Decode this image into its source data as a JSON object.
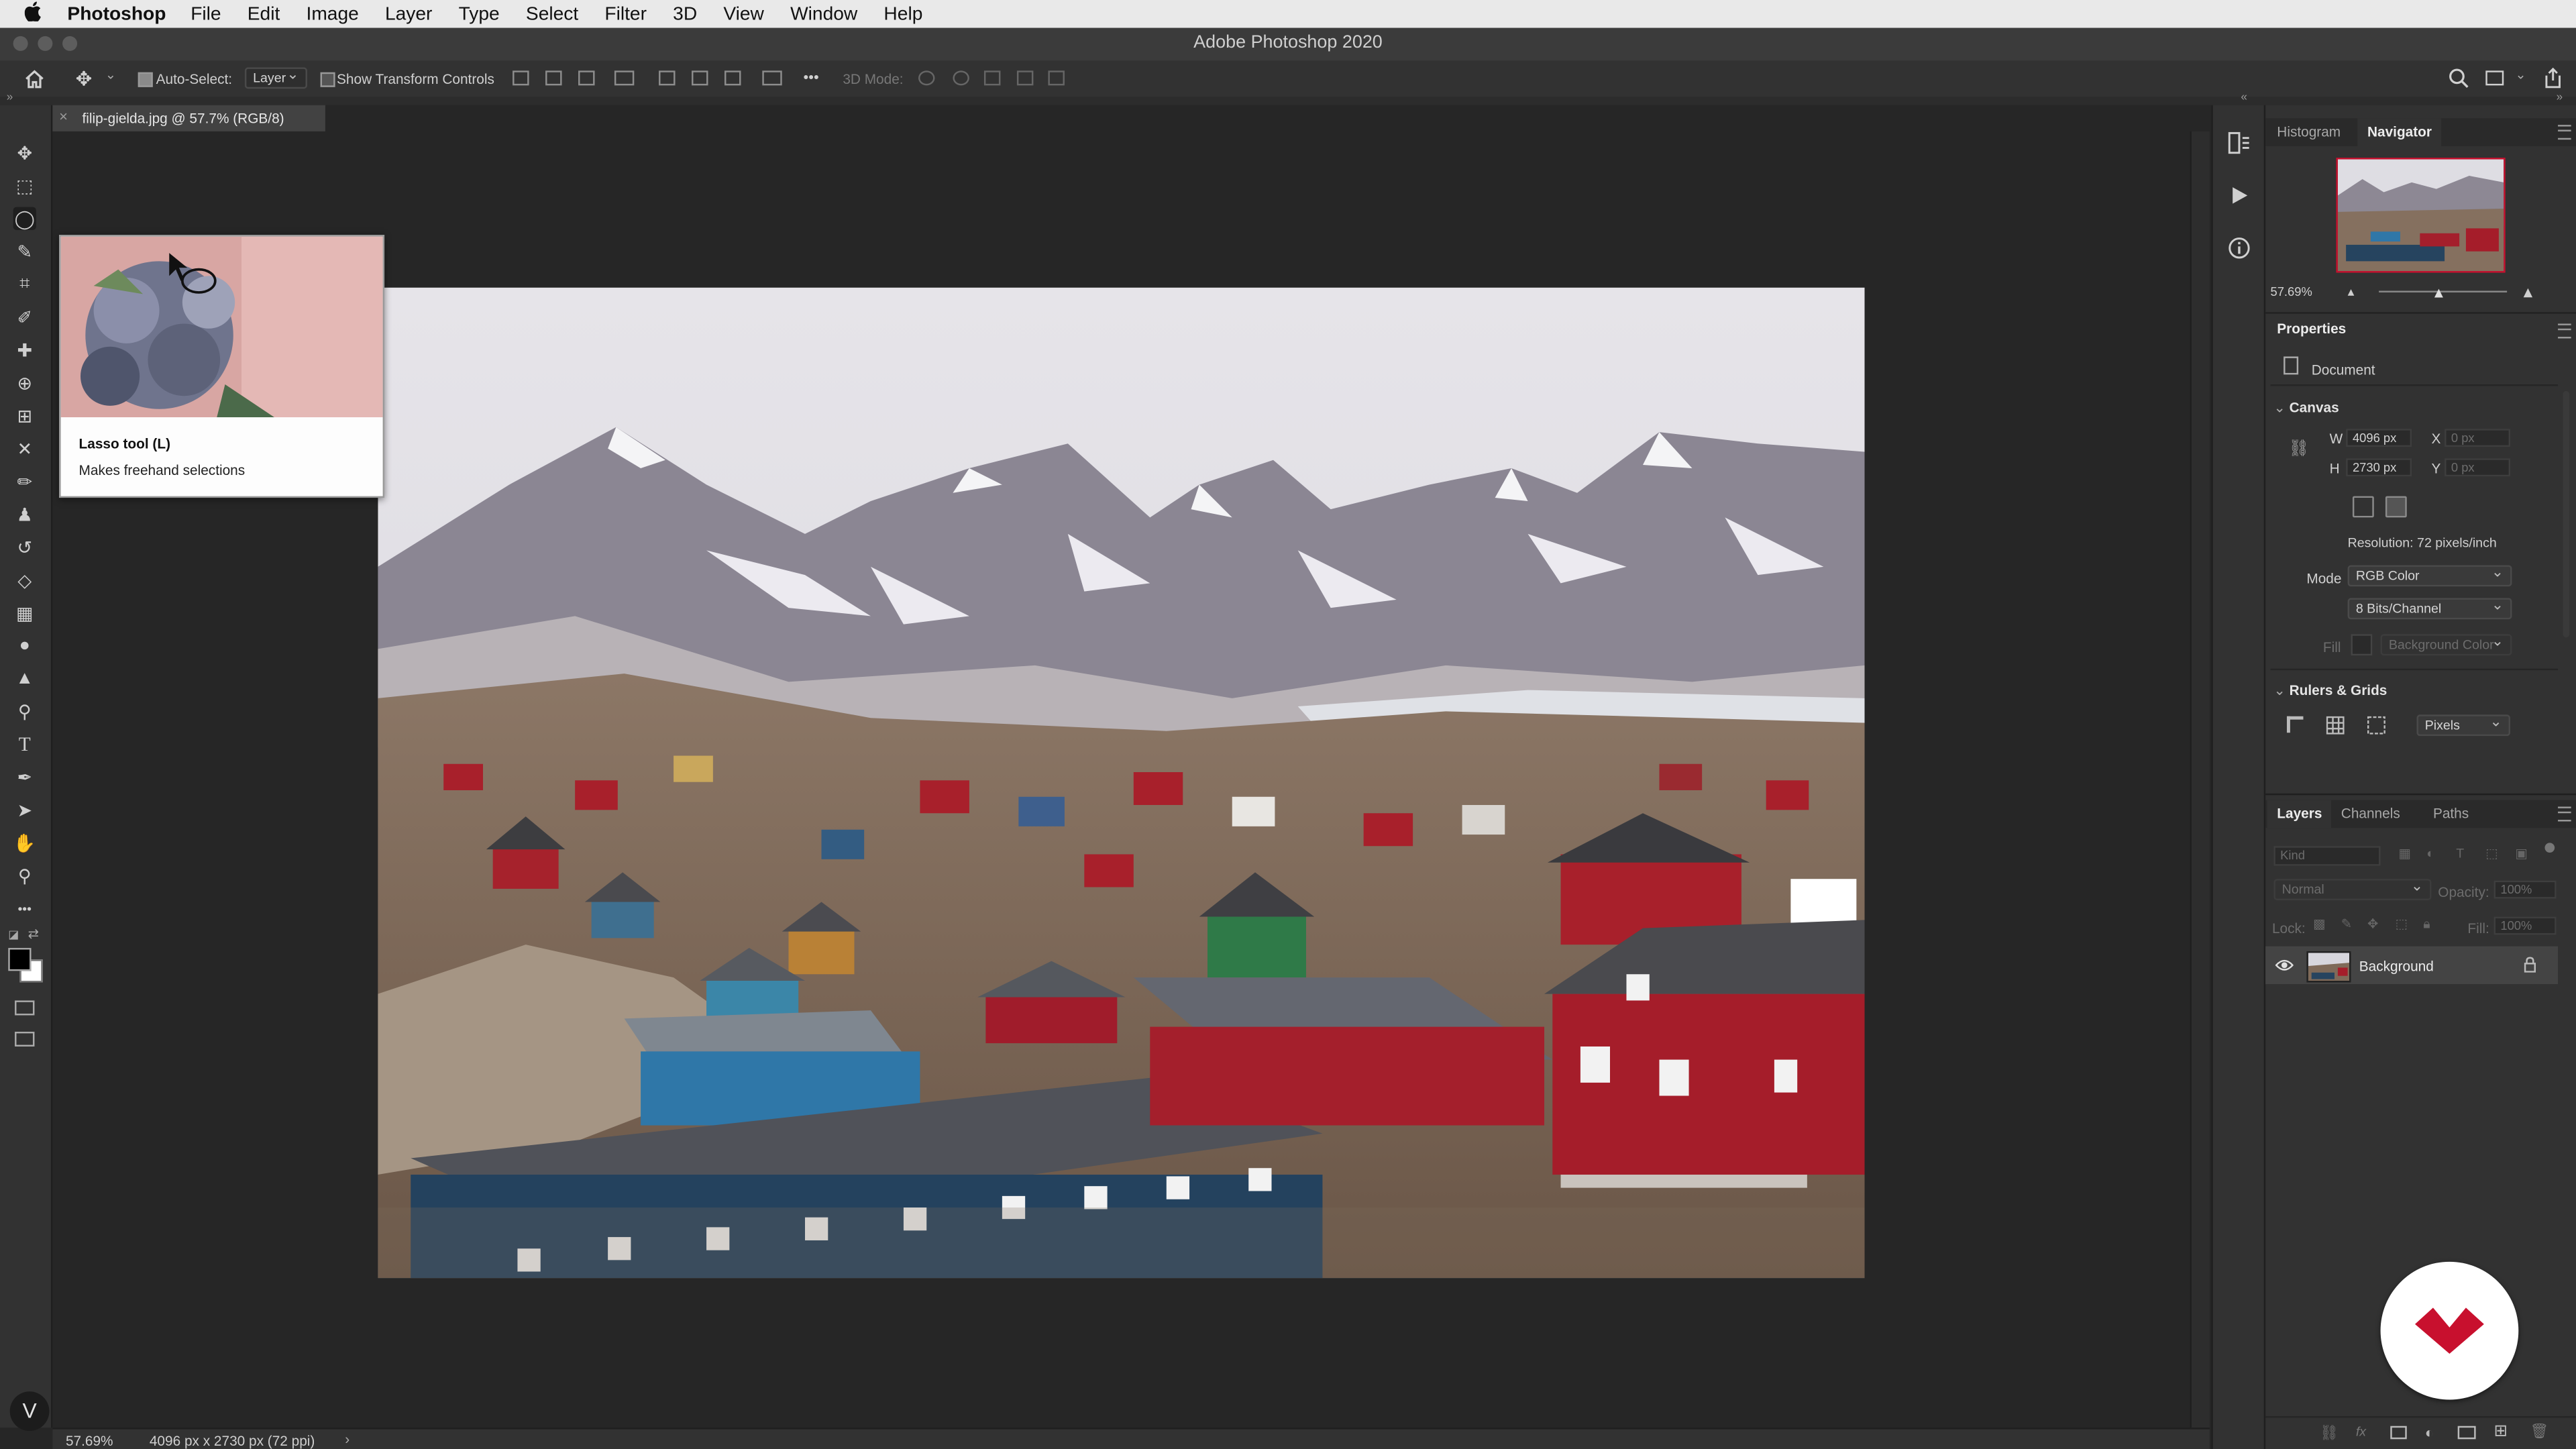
{
  "menubar": {
    "app_name": "Photoshop",
    "items": [
      "File",
      "Edit",
      "Image",
      "Layer",
      "Type",
      "Select",
      "Filter",
      "3D",
      "View",
      "Window",
      "Help"
    ]
  },
  "window": {
    "title": "Adobe Photoshop 2020"
  },
  "options_bar": {
    "auto_select_label": "Auto-Select:",
    "auto_select_checked": true,
    "auto_select_target": "Layer",
    "show_transform_label": "Show Transform Controls",
    "show_transform_checked": false,
    "more_label": "•••",
    "mode_3d_label": "3D Mode:"
  },
  "document": {
    "tab_label": "filip-gielda.jpg @ 57.7% (RGB/8)",
    "close_symbol": "×"
  },
  "tooltip": {
    "title": "Lasso tool (L)",
    "description": "Makes freehand selections"
  },
  "status_bar": {
    "zoom": "57.69%",
    "doc_info": "4096 px x 2730 px (72 ppi)",
    "arrow": "›"
  },
  "tools": [
    {
      "name": "move-tool",
      "glyph": "✥"
    },
    {
      "name": "marquee-tool",
      "glyph": "⬚"
    },
    {
      "name": "lasso-tool",
      "glyph": "◯",
      "active": true
    },
    {
      "name": "quick-selection-tool",
      "glyph": "✎"
    },
    {
      "name": "crop-tool",
      "glyph": "⌗"
    },
    {
      "name": "eyedropper-tool",
      "glyph": "✐"
    },
    {
      "name": "spot-healing-tool",
      "glyph": "✚"
    },
    {
      "name": "healing-tool",
      "glyph": "⊕"
    },
    {
      "name": "frame-tool",
      "glyph": "⊞"
    },
    {
      "name": "patch-tool",
      "glyph": "✕"
    },
    {
      "name": "brush-tool",
      "glyph": "✏"
    },
    {
      "name": "clone-stamp-tool",
      "glyph": "♟"
    },
    {
      "name": "history-brush-tool",
      "glyph": "↺"
    },
    {
      "name": "eraser-tool",
      "glyph": "◇"
    },
    {
      "name": "gradient-tool",
      "glyph": "▦"
    },
    {
      "name": "blur-tool",
      "glyph": "●"
    },
    {
      "name": "sharpen-tool",
      "glyph": "▲"
    },
    {
      "name": "dodge-tool",
      "glyph": "⚲"
    },
    {
      "name": "type-tool",
      "glyph": "T"
    },
    {
      "name": "pen-tool",
      "glyph": "✒"
    },
    {
      "name": "path-selection-tool",
      "glyph": "➤"
    },
    {
      "name": "hand-tool",
      "glyph": "✋"
    },
    {
      "name": "zoom-tool",
      "glyph": "⚲"
    },
    {
      "name": "edit-toolbar",
      "glyph": "•••"
    }
  ],
  "navigator": {
    "tabs": [
      "Histogram",
      "Navigator"
    ],
    "active_tab": "Navigator",
    "zoom": "57.69%"
  },
  "properties": {
    "title": "Properties",
    "document_label": "Document",
    "canvas_section": "Canvas",
    "w_label": "W",
    "w_value": "4096 px",
    "h_label": "H",
    "h_value": "2730 px",
    "x_label": "X",
    "x_placeholder": "0 px",
    "y_label": "Y",
    "y_placeholder": "0 px",
    "resolution": "Resolution: 72 pixels/inch",
    "mode_label": "Mode",
    "mode_value": "RGB Color",
    "bits_value": "8 Bits/Channel",
    "fill_label": "Fill",
    "fill_value": "Background Color",
    "rulers_section": "Rulers & Grids",
    "units_value": "Pixels"
  },
  "layers": {
    "tabs": [
      "Layers",
      "Channels",
      "Paths"
    ],
    "active_tab": "Layers",
    "kind_placeholder": "Kind",
    "blend_mode": "Normal",
    "opacity_label": "Opacity:",
    "opacity_value": "100%",
    "lock_label": "Lock:",
    "fill_label": "Fill:",
    "fill_value": "100%",
    "items": [
      {
        "name": "Background",
        "visible": true,
        "locked": true
      }
    ]
  },
  "colors": {
    "accent_red": "#c8102e",
    "foreground_swatch": "#000000",
    "background_swatch": "#ffffff"
  }
}
